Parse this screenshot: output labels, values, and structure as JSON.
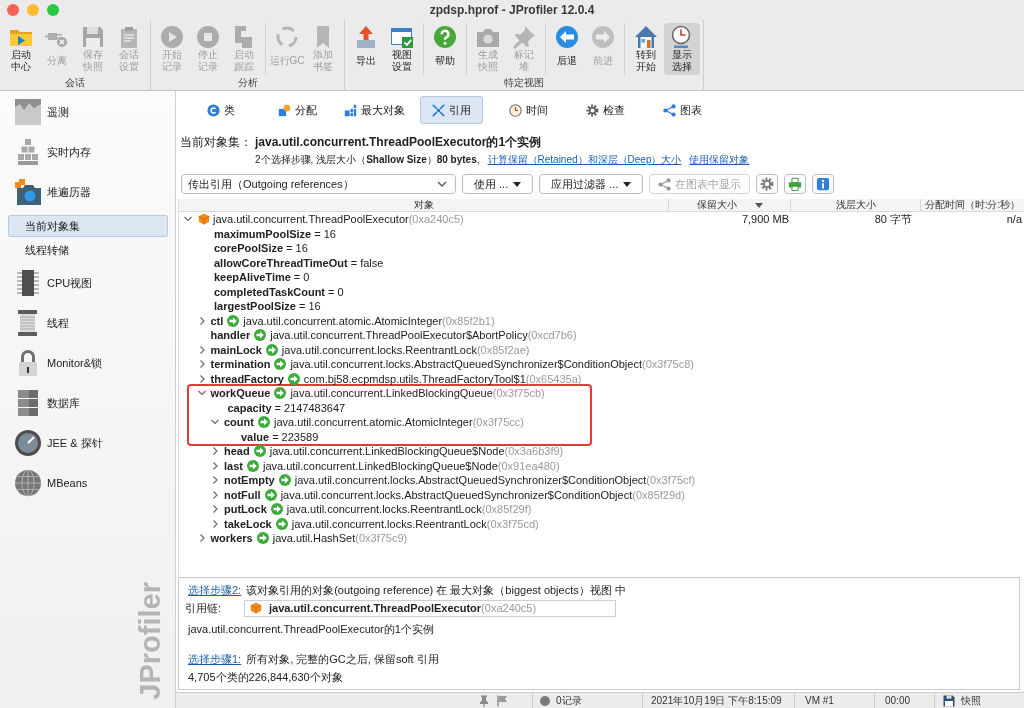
{
  "window": {
    "title": "zpdsp.hprof - JProfiler 12.0.4"
  },
  "toolbar": {
    "groups": [
      {
        "label": "会话",
        "clusters": [
          [
            {
              "lines": [
                "启动",
                "中心"
              ],
              "disabled": false,
              "selected": false
            },
            {
              "lines": [
                "分离"
              ],
              "disabled": true,
              "selected": false
            },
            {
              "lines": [
                "保存",
                "快照"
              ],
              "disabled": true,
              "selected": false
            },
            {
              "lines": [
                "会话",
                "设置"
              ],
              "disabled": true,
              "selected": false
            }
          ]
        ]
      },
      {
        "label": "分析",
        "clusters": [
          [
            {
              "lines": [
                "开始",
                "记录"
              ],
              "disabled": true,
              "selected": false
            },
            {
              "lines": [
                "停止",
                "记录"
              ],
              "disabled": true,
              "selected": false
            },
            {
              "lines": [
                "启动",
                "跟踪"
              ],
              "disabled": true,
              "selected": false
            }
          ],
          [
            {
              "lines": [
                "运行GC"
              ],
              "disabled": true,
              "selected": false
            },
            {
              "lines": [
                "添加",
                "书签"
              ],
              "disabled": true,
              "selected": false
            }
          ]
        ]
      },
      {
        "label": "特定视图",
        "clusters": [
          [
            {
              "lines": [
                "导出"
              ],
              "disabled": false,
              "selected": false
            },
            {
              "lines": [
                "视图",
                "设置"
              ],
              "disabled": false,
              "selected": false
            }
          ],
          [
            {
              "lines": [
                "帮助"
              ],
              "disabled": false,
              "selected": false
            }
          ],
          [
            {
              "lines": [
                "生成",
                "快照"
              ],
              "disabled": true,
              "selected": false
            },
            {
              "lines": [
                "标记",
                "堆"
              ],
              "disabled": true,
              "selected": false
            }
          ],
          [
            {
              "lines": [
                "后退"
              ],
              "disabled": false,
              "selected": false
            },
            {
              "lines": [
                "前进"
              ],
              "disabled": true,
              "selected": false
            }
          ],
          [
            {
              "lines": [
                "转到",
                "开始"
              ],
              "disabled": false,
              "selected": false
            },
            {
              "lines": [
                "显示",
                "选择"
              ],
              "disabled": false,
              "selected": true
            }
          ]
        ]
      }
    ]
  },
  "sidebar": {
    "items": [
      {
        "label": "遥测",
        "selected": false
      },
      {
        "label": "实时内存",
        "selected": false
      },
      {
        "label": "堆遍历器",
        "selected": false,
        "children": [
          {
            "label": "当前对象集",
            "selected": true
          },
          {
            "label": "线程转储",
            "selected": false
          }
        ]
      },
      {
        "label": "CPU视图",
        "selected": false
      },
      {
        "label": "线程",
        "selected": false
      },
      {
        "label": "Monitor&锁",
        "selected": false
      },
      {
        "label": "数据库",
        "selected": false
      },
      {
        "label": "JEE & 探针",
        "selected": false
      },
      {
        "label": "MBeans",
        "selected": false
      }
    ],
    "brand": "JProfiler"
  },
  "tabs": [
    {
      "label": "类",
      "selected": false
    },
    {
      "label": "分配",
      "selected": false
    },
    {
      "label": "最大对象",
      "selected": false
    },
    {
      "label": "引用",
      "selected": true
    },
    {
      "label": "时间",
      "selected": false
    },
    {
      "label": "检查",
      "selected": false
    },
    {
      "label": "图表",
      "selected": false
    }
  ],
  "object_set": {
    "label": "当前对象集：",
    "title": "java.util.concurrent.ThreadPoolExecutor的1个实例",
    "summary": "2个选择步骤, 浅层大小（**Shallow Size**）**80 bytes**,",
    "links": [
      "计算保留（Retained）和深层（Deep）大小",
      "使用保留对象"
    ]
  },
  "filters": {
    "view": {
      "value": "传出引用（Outgoing references）"
    },
    "buttons": [
      {
        "kind": "menu",
        "label": "使用 ...",
        "disabled": false
      },
      {
        "kind": "menu",
        "label": "应用过滤器 ...",
        "disabled": false
      },
      {
        "kind": "icon-label",
        "label": "在图表中显示",
        "disabled": true
      },
      {
        "kind": "icon",
        "disabled": false
      },
      {
        "kind": "icon",
        "disabled": false
      },
      {
        "kind": "icon",
        "disabled": false
      }
    ]
  },
  "table": {
    "columns": [
      {
        "label": "对象",
        "sorted": false
      },
      {
        "label": "保留大小",
        "sorted": true
      },
      {
        "label": "浅层大小",
        "sorted": false
      },
      {
        "label": "分配时间（时:分:秒）",
        "sorted": false
      }
    ],
    "tree": [
      {
        "kind": "object",
        "type": "java.util.concurrent.ThreadPoolExecutor",
        "address": "(0xa240c5)",
        "retained": "7,900 MB",
        "shallow": "80 字节",
        "allocated": "n/a",
        "expanded": true,
        "highlighted": false,
        "children": [
          {
            "kind": "primitive",
            "field": "maximumPoolSize",
            "value": "= 16",
            "highlighted": false
          },
          {
            "kind": "primitive",
            "field": "corePoolSize",
            "value": "= 16",
            "highlighted": false
          },
          {
            "kind": "primitive",
            "field": "allowCoreThreadTimeOut",
            "value": "= false",
            "highlighted": false
          },
          {
            "kind": "primitive",
            "field": "keepAliveTime",
            "value": "= 0",
            "highlighted": false
          },
          {
            "kind": "primitive",
            "field": "completedTaskCount",
            "value": "= 0",
            "highlighted": false
          },
          {
            "kind": "primitive",
            "field": "largestPoolSize",
            "value": "= 16",
            "highlighted": false
          },
          {
            "kind": "reference",
            "field": "ctl",
            "type": "java.util.concurrent.atomic.AtomicInteger",
            "address": "(0x85f2b1)",
            "expanded": false,
            "highlighted": false
          },
          {
            "kind": "reference",
            "field": "handler",
            "type": "java.util.concurrent.ThreadPoolExecutor$AbortPolicy",
            "address": "(0xcd7b6)",
            "highlighted": false
          },
          {
            "kind": "reference",
            "field": "mainLock",
            "type": "java.util.concurrent.locks.ReentrantLock",
            "address": "(0x85f2ae)",
            "expanded": false,
            "highlighted": false
          },
          {
            "kind": "reference",
            "field": "termination",
            "type": "java.util.concurrent.locks.AbstractQueuedSynchronizer$ConditionObject",
            "address": "(0x3f75c8)",
            "expanded": false,
            "highlighted": false
          },
          {
            "kind": "reference",
            "field": "threadFactory",
            "type": "com.bj58.ecpmdsp.utils.ThreadFactoryTool$1",
            "address": "(0x65435a)",
            "expanded": false,
            "highlighted": false
          },
          {
            "kind": "reference",
            "field": "workQueue",
            "type": "java.util.concurrent.LinkedBlockingQueue",
            "address": "(0x3f75cb)",
            "expanded": true,
            "highlighted": true,
            "children": [
              {
                "kind": "primitive",
                "field": "capacity",
                "value": "= 2147483647",
                "highlighted": true
              },
              {
                "kind": "reference",
                "field": "count",
                "type": "java.util.concurrent.atomic.AtomicInteger",
                "address": "(0x3f75cc)",
                "expanded": true,
                "highlighted": true,
                "children": [
                  {
                    "kind": "primitive",
                    "field": "value",
                    "value": "= 223589",
                    "highlighted": true
                  }
                ]
              },
              {
                "kind": "reference",
                "field": "head",
                "type": "java.util.concurrent.LinkedBlockingQueue$Node",
                "address": "(0x3a6b3f9)",
                "expanded": false,
                "highlighted": false
              },
              {
                "kind": "reference",
                "field": "last",
                "type": "java.util.concurrent.LinkedBlockingQueue$Node",
                "address": "(0x91ea480)",
                "expanded": false,
                "highlighted": false
              },
              {
                "kind": "reference",
                "field": "notEmpty",
                "type": "java.util.concurrent.locks.AbstractQueuedSynchronizer$ConditionObject",
                "address": "(0x3f75cf)",
                "expanded": false,
                "highlighted": false
              },
              {
                "kind": "reference",
                "field": "notFull",
                "type": "java.util.concurrent.locks.AbstractQueuedSynchronizer$ConditionObject",
                "address": "(0x85f29d)",
                "expanded": false,
                "highlighted": false
              },
              {
                "kind": "reference",
                "field": "putLock",
                "type": "java.util.concurrent.locks.ReentrantLock",
                "address": "(0x85f29f)",
                "expanded": false,
                "highlighted": false
              },
              {
                "kind": "reference",
                "field": "takeLock",
                "type": "java.util.concurrent.locks.ReentrantLock",
                "address": "(0x3f75cd)",
                "expanded": false,
                "highlighted": false
              }
            ]
          },
          {
            "kind": "reference",
            "field": "workers",
            "type": "java.util.HashSet",
            "address": "(0x3f75c9)",
            "expanded": false,
            "highlighted": false
          }
        ]
      }
    ]
  },
  "selection_steps": [
    {
      "link": "选择步骤2:",
      "description": "该对象引用的对象(outgoing reference) 在 最大对象（biggest objects）视图 中",
      "chain_label": "引用链:",
      "chain": {
        "type": "java.util.concurrent.ThreadPoolExecutor",
        "address": "(0xa240c5)"
      },
      "result": "java.util.concurrent.ThreadPoolExecutor的1个实例"
    },
    {
      "link": "选择步骤1:",
      "description": "所有对象, 完整的GC之后, 保留soft 引用",
      "result": "4,705个类的226,844,630个对象"
    }
  ],
  "status_bar": {
    "recordings": "0记录",
    "timestamp": "2021年10月19日 下午8:15:09",
    "vm": "VM #1",
    "elapsed": "00:00",
    "mode": "快照"
  }
}
